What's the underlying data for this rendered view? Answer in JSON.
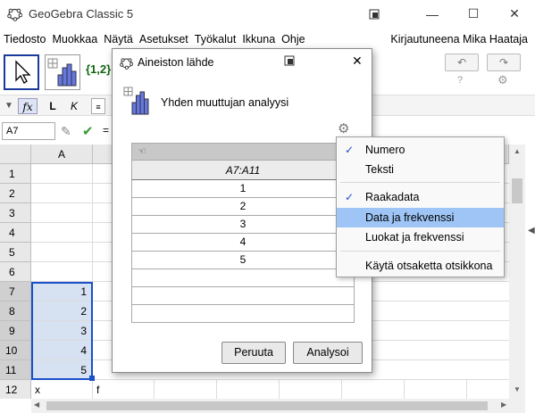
{
  "window": {
    "title": "GeoGebra Classic 5",
    "minimize": "—",
    "maximize": "☐",
    "close": "✕"
  },
  "menubar": {
    "items": [
      "Tiedosto",
      "Muokkaa",
      "Näytä",
      "Asetukset",
      "Työkalut",
      "Ikkuna",
      "Ohje"
    ],
    "user": "Kirjautuneena Mika Haataja"
  },
  "toolbar": {
    "list_tool_label": "{1,2}",
    "undo": "↶",
    "redo": "↷"
  },
  "formatbar": {
    "bold": "L",
    "italic": "K"
  },
  "inputrow": {
    "cell_ref": "A7",
    "equals": "="
  },
  "sheet": {
    "columns": [
      "A"
    ],
    "rows": [
      {
        "n": "1",
        "a": "",
        "b": ""
      },
      {
        "n": "2",
        "a": "",
        "b": ""
      },
      {
        "n": "3",
        "a": "",
        "b": ""
      },
      {
        "n": "4",
        "a": "",
        "b": ""
      },
      {
        "n": "5",
        "a": "",
        "b": ""
      },
      {
        "n": "6",
        "a": "",
        "b": ""
      },
      {
        "n": "7",
        "a": "1",
        "b": ""
      },
      {
        "n": "8",
        "a": "2",
        "b": ""
      },
      {
        "n": "9",
        "a": "3",
        "b": ""
      },
      {
        "n": "10",
        "a": "4",
        "b": ""
      },
      {
        "n": "11",
        "a": "5",
        "b": ""
      },
      {
        "n": "12",
        "a": "x",
        "b": "f"
      }
    ]
  },
  "dialog": {
    "title": "Aineiston lähde",
    "header_label": "Yhden muuttujan analyysi",
    "table_header": "A7:A11",
    "values": [
      "1",
      "2",
      "3",
      "4",
      "5",
      "",
      "",
      ""
    ],
    "cancel": "Peruuta",
    "analyze": "Analysoi"
  },
  "popup": {
    "items": [
      {
        "label": "Numero",
        "checked": "✓"
      },
      {
        "label": "Teksti",
        "checked": ""
      },
      {
        "label": "Raakadata",
        "checked": "✓"
      },
      {
        "label": "Data ja frekvenssi",
        "checked": ""
      },
      {
        "label": "Luokat ja frekvenssi",
        "checked": ""
      },
      {
        "label": "Käytä otsaketta otsikkona",
        "checked": ""
      }
    ],
    "highlighted": "Data ja frekvenssi"
  }
}
